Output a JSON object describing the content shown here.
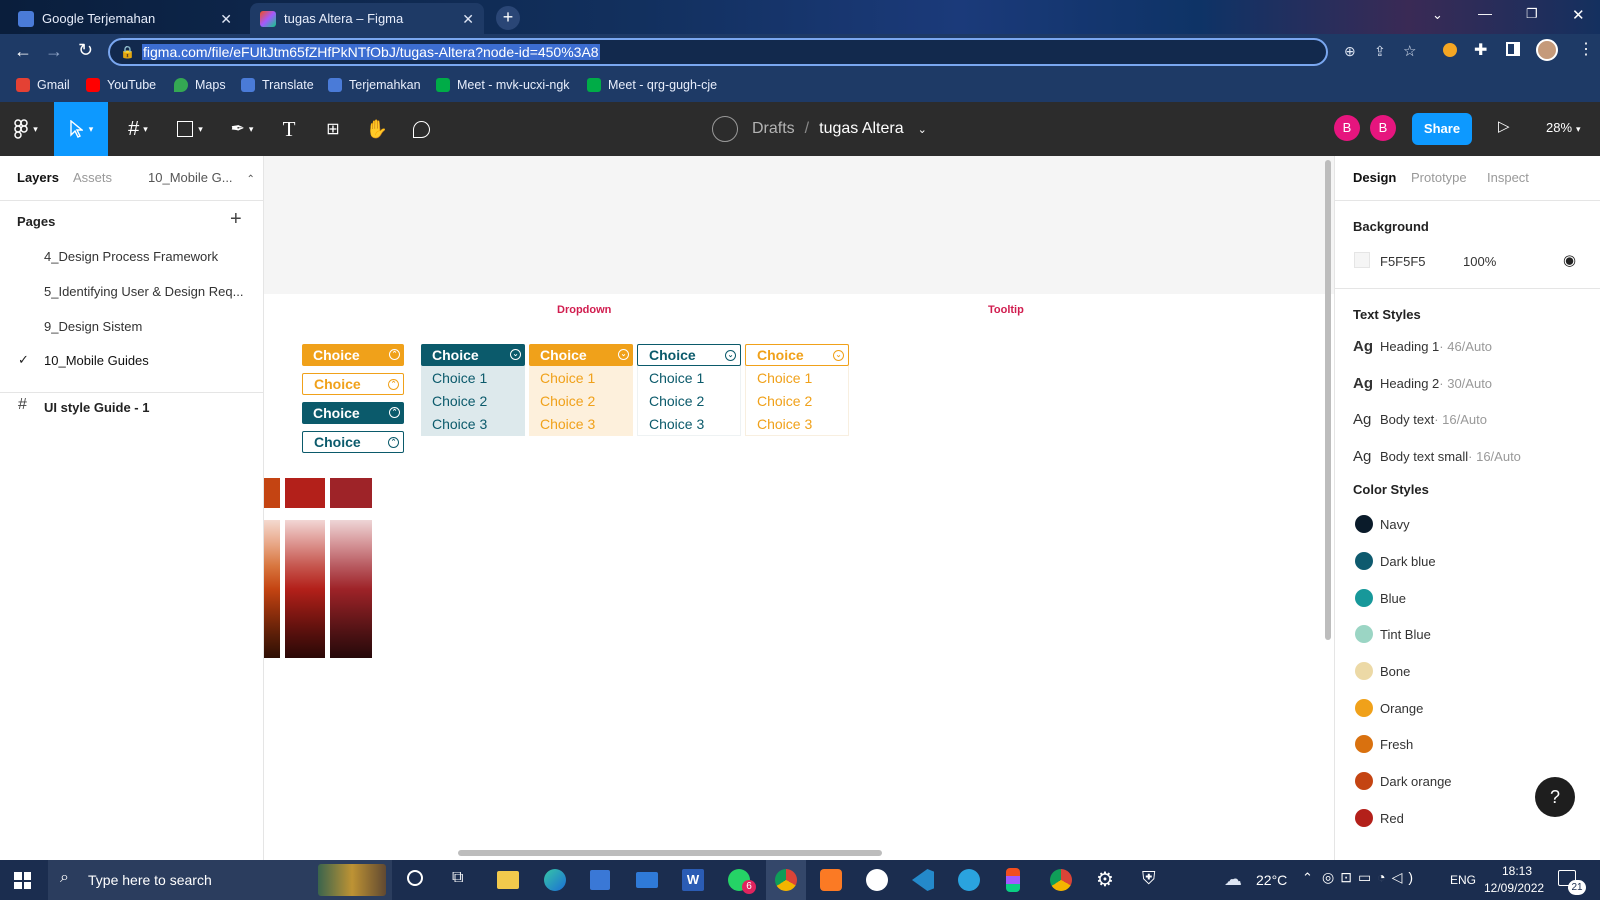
{
  "browser": {
    "tabs": [
      {
        "title": "Google Terjemahan",
        "active": false
      },
      {
        "title": "tugas Altera – Figma",
        "active": true
      }
    ],
    "url": "figma.com/file/eFUltJtm65fZHfPkNTfObJ/tugas-Altera?node-id=450%3A8",
    "bookmarks": [
      "Gmail",
      "YouTube",
      "Maps",
      "Translate",
      "Terjemahkan",
      "Meet - mvk-ucxi-ngk",
      "Meet - qrg-gugh-cje"
    ]
  },
  "figma": {
    "breadcrumb_drafts": "Drafts",
    "breadcrumb_sep": "/",
    "file_name": "tugas Altera",
    "avatars": [
      "B",
      "B"
    ],
    "share_label": "Share",
    "zoom": "28%"
  },
  "left_panel": {
    "tabs": [
      "Layers",
      "Assets"
    ],
    "page_selector": "10_Mobile G...",
    "pages_label": "Pages",
    "pages": [
      {
        "name": "4_Design Process Framework",
        "current": false
      },
      {
        "name": "5_Identifying User & Design Req...",
        "current": false
      },
      {
        "name": "9_Design Sistem",
        "current": false
      },
      {
        "name": "10_Mobile Guides",
        "current": true
      }
    ],
    "layers": [
      {
        "name": "UI style Guide - 1"
      }
    ]
  },
  "canvas": {
    "dropdown_title": "Dropdown",
    "tooltip_title": "Tooltip",
    "choice_label": "Choice",
    "options": [
      "Choice 1",
      "Choice 2",
      "Choice 3"
    ]
  },
  "right_panel": {
    "tabs": [
      "Design",
      "Prototype",
      "Inspect"
    ],
    "background_label": "Background",
    "bg_hex": "F5F5F5",
    "bg_opacity": "100%",
    "text_styles_label": "Text Styles",
    "text_styles": [
      {
        "ag": "Ag",
        "name": "Heading 1",
        "meta": " · 46/Auto",
        "bold": true
      },
      {
        "ag": "Ag",
        "name": "Heading 2",
        "meta": " · 30/Auto",
        "bold": true
      },
      {
        "ag": "Ag",
        "name": "Body text",
        "meta": " · 16/Auto",
        "bold": false
      },
      {
        "ag": "Ag",
        "name": "Body text small",
        "meta": " · 16/Auto",
        "bold": false
      }
    ],
    "color_styles_label": "Color Styles",
    "color_styles": [
      {
        "name": "Navy",
        "color": "#0a1b2a"
      },
      {
        "name": "Dark blue",
        "color": "#0e5a6e"
      },
      {
        "name": "Blue",
        "color": "#17989a"
      },
      {
        "name": "Tint Blue",
        "color": "#9bd5c4"
      },
      {
        "name": "Bone",
        "color": "#ecd9a6"
      },
      {
        "name": "Orange",
        "color": "#f0a11a"
      },
      {
        "name": "Fresh",
        "color": "#d9710f"
      },
      {
        "name": "Dark orange",
        "color": "#c44412"
      },
      {
        "name": "Red",
        "color": "#b3201a"
      }
    ],
    "help_label": "?"
  },
  "taskbar": {
    "search_placeholder": "Type here to search",
    "weather": "22°C",
    "lang": "ENG",
    "time": "18:13",
    "date": "12/09/2022",
    "whatsapp_badge": "6",
    "notif_count": "21"
  },
  "colors": {
    "dark_teal": "#0b5a6b",
    "orange": "#f0a11a",
    "pink_title": "#d11d4f",
    "share_blue": "#0d99ff",
    "avatar_pink": "#e6157e"
  }
}
